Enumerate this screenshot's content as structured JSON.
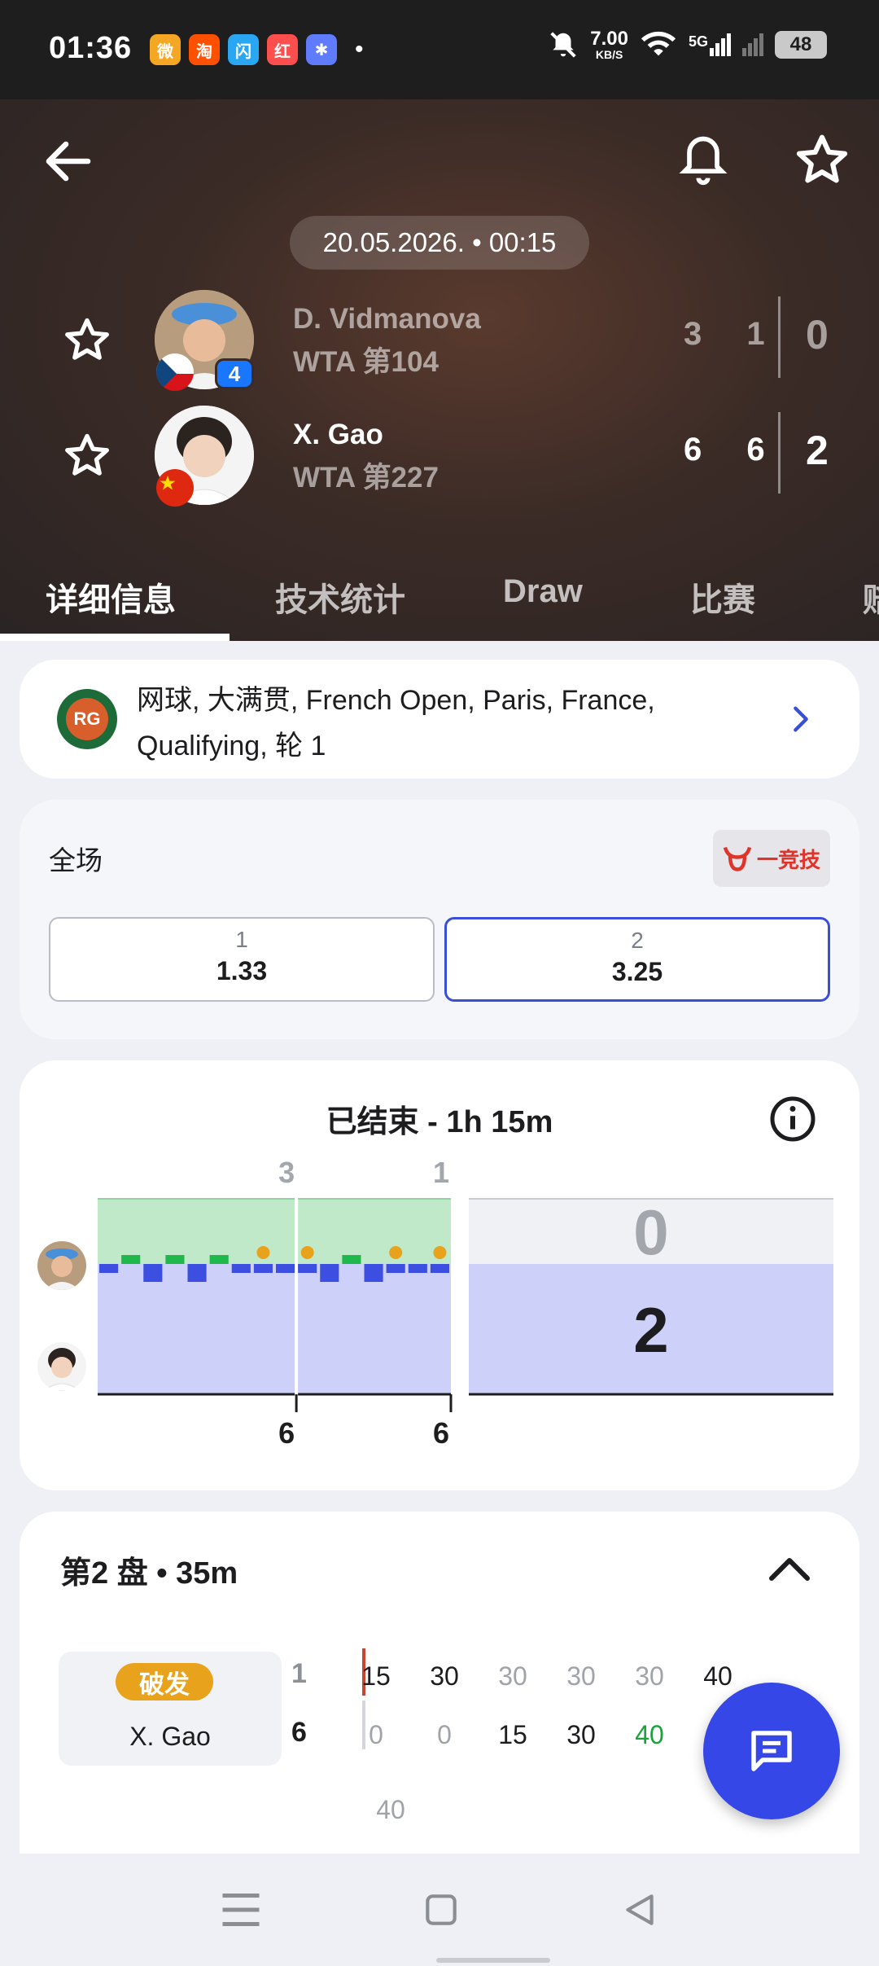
{
  "status_bar": {
    "time": "01:36",
    "app_icons": [
      {
        "name": "weibo-icon",
        "glyph": "微",
        "color": "#f5a623"
      },
      {
        "name": "taobao-icon",
        "glyph": "淘",
        "color": "#ff5000"
      },
      {
        "name": "taobao-flash-icon",
        "glyph": "闪",
        "color": "#2aa7f2"
      },
      {
        "name": "xiaohongshu-icon",
        "glyph": "红",
        "color": "#ff4e4e"
      },
      {
        "name": "photos-icon",
        "glyph": "✱",
        "color": "#5f7cff"
      }
    ],
    "dot": "•",
    "speed_value": "7.00",
    "speed_unit": "KB/S",
    "network": "5G",
    "battery": "48"
  },
  "header": {
    "datetime": "20.05.2026. • 00:15",
    "players": [
      {
        "name": "D. Vidmanova",
        "rank": "WTA 第104",
        "seed": "4",
        "flag": "czech",
        "sets": "3 1",
        "total": "0"
      },
      {
        "name": "X. Gao",
        "rank": "WTA 第227",
        "seed": "",
        "flag": "china",
        "sets": "6 6",
        "total": "2"
      }
    ],
    "tabs": [
      "详细信息",
      "技术统计",
      "Draw",
      "比赛",
      "赔"
    ]
  },
  "tournament": {
    "logo_text": "RG",
    "text": "网球, 大满贯, French Open, Paris, France, Qualifying, 轮 1"
  },
  "odds": {
    "label": "全场",
    "brand_text": "一竞技",
    "options": [
      {
        "key": "1",
        "value": "1.33"
      },
      {
        "key": "2",
        "value": "3.25"
      }
    ]
  },
  "momentum": {
    "title": "已结束 - 1h 15m",
    "set_scores_top": [
      "3",
      "1"
    ],
    "set_scores_bottom": [
      "6",
      "6"
    ],
    "total_top": "0",
    "total_bottom": "2"
  },
  "chart_data": {
    "type": "bar",
    "title": "已结束 - 1h 15m",
    "series": [
      {
        "name": "D. Vidmanova",
        "sets_won_games": [
          3,
          1
        ],
        "sets_total": 0
      },
      {
        "name": "X. Gao",
        "sets_won_games": [
          6,
          6
        ],
        "sets_total": 2
      }
    ],
    "games": [
      {
        "set": 1,
        "v": -1,
        "bp": false
      },
      {
        "set": 1,
        "v": 1,
        "bp": false
      },
      {
        "set": 1,
        "v": -2,
        "bp": false
      },
      {
        "set": 1,
        "v": 1,
        "bp": false
      },
      {
        "set": 1,
        "v": -2,
        "bp": false
      },
      {
        "set": 1,
        "v": 1,
        "bp": false
      },
      {
        "set": 1,
        "v": -1,
        "bp": false
      },
      {
        "set": 1,
        "v": -1,
        "bp": true
      },
      {
        "set": 1,
        "v": -1,
        "bp": false
      },
      {
        "set": 2,
        "v": -1,
        "bp": true
      },
      {
        "set": 2,
        "v": -2,
        "bp": false
      },
      {
        "set": 2,
        "v": 1,
        "bp": false
      },
      {
        "set": 2,
        "v": -2,
        "bp": false
      },
      {
        "set": 2,
        "v": -1,
        "bp": true
      },
      {
        "set": 2,
        "v": -1,
        "bp": false
      },
      {
        "set": 2,
        "v": -1,
        "bp": true
      }
    ],
    "colors": {
      "player1_win": "#1fb84b",
      "player2_win": "#3c4fe0",
      "player1_area": "#bfe9c9",
      "player2_area": "#cdd1fa",
      "break": "#e9a21c"
    }
  },
  "set_detail": {
    "title": "第2 盘 • 35m",
    "badge": "破发",
    "server": "X. Gao",
    "game_score_top": "1",
    "game_score_bottom": "6",
    "points_top": [
      "15",
      "30",
      "30",
      "30",
      "30",
      "40"
    ],
    "points_bottom": [
      "0",
      "0",
      "15",
      "30",
      "40",
      ""
    ],
    "extra_point": "40"
  }
}
